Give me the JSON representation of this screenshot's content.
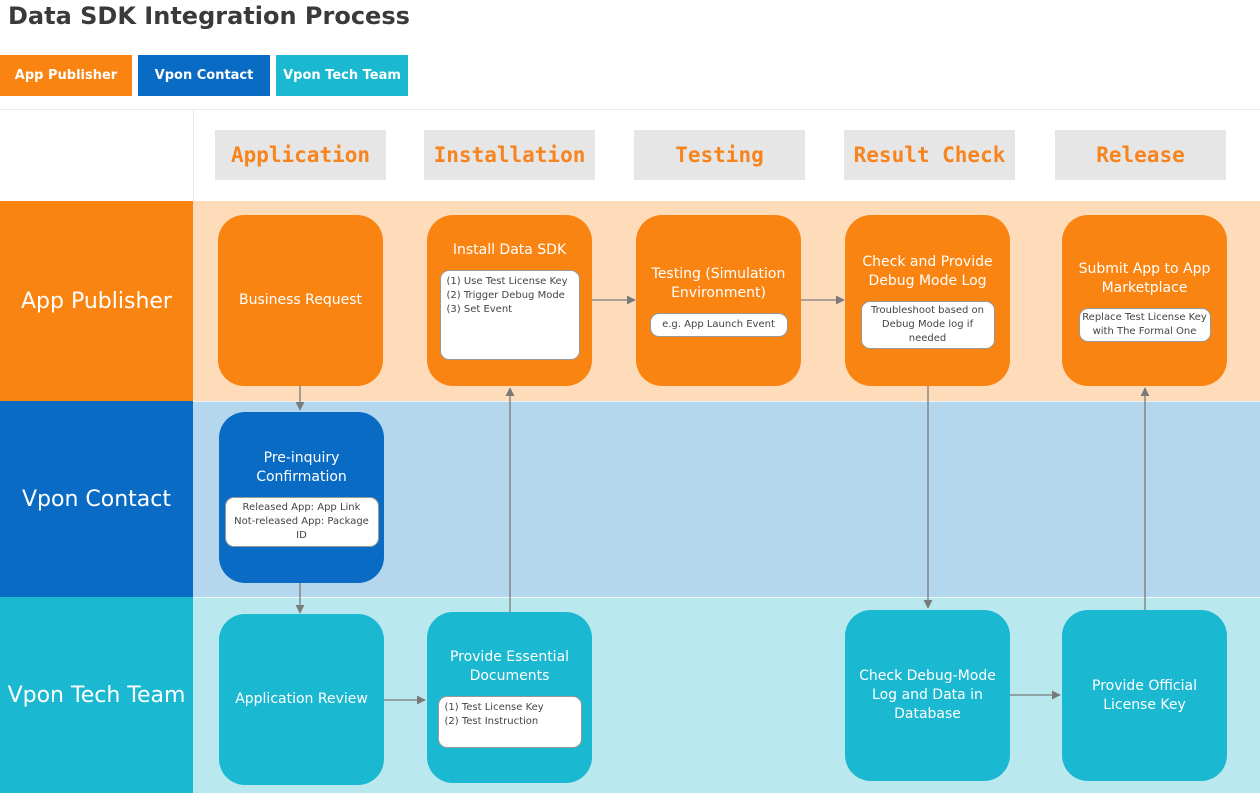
{
  "title": "Data SDK Integration Process",
  "legend": {
    "publisher": "App Publisher",
    "contact": "Vpon Contact",
    "tech": "Vpon Tech Team"
  },
  "colors": {
    "publisher": "#fa8411",
    "contact": "#0a6bc4",
    "tech": "#1ab9d1",
    "publisher_lane": "#fedcba",
    "contact_lane": "#b5d7ee",
    "tech_lane": "#b9e8ef",
    "phase_text": "#f7841e"
  },
  "phases": [
    "Application",
    "Installation",
    "Testing",
    "Result Check",
    "Release"
  ],
  "lanes": {
    "publisher": "App Publisher",
    "contact": "Vpon Contact",
    "tech": "Vpon Tech Team"
  },
  "steps": {
    "business_request": {
      "title": "Business Request"
    },
    "install_sdk": {
      "title": "Install Data SDK",
      "note": [
        "(1) Use Test License Key",
        "(2) Trigger Debug Mode",
        "(3) Set Event"
      ]
    },
    "testing": {
      "title": "Testing (Simulation Environment)",
      "note": [
        "e.g. App Launch Event"
      ]
    },
    "check_provide": {
      "title": "Check and Provide Debug Mode Log",
      "note": [
        "Troubleshoot based on",
        "Debug Mode log if needed"
      ]
    },
    "submit_app": {
      "title": "Submit App to App Marketplace",
      "note": [
        "Replace Test License Key",
        "with The Formal One"
      ]
    },
    "pre_inquiry": {
      "title": "Pre-inquiry Confirmation",
      "note": [
        "Released App: App Link",
        "Not-released App: Package ID"
      ]
    },
    "app_review": {
      "title": "Application Review"
    },
    "provide_docs": {
      "title": "Provide Essential Documents",
      "note": [
        "(1) Test License Key",
        "(2) Test Instruction"
      ]
    },
    "check_debug": {
      "title": "Check Debug-Mode Log and Data in Database"
    },
    "provide_license": {
      "title": "Provide Official License Key"
    }
  }
}
